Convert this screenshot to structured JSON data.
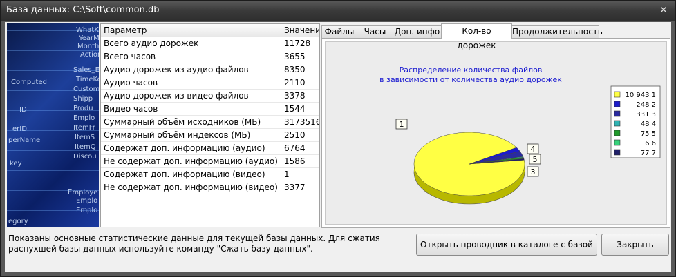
{
  "window": {
    "title": "База данных: C:\\Soft\\common.db",
    "close_glyph": "✕"
  },
  "side_image": {
    "words": [
      "WhatK",
      "YearM",
      "MonthI",
      "Action",
      "Sales_E",
      "TimeKe",
      "Custom",
      "Shipp",
      "Produ",
      "Emplo",
      "ItemFr",
      "ItemS",
      "ItemQ",
      "Discou",
      "Employe",
      "Emplo",
      "Emplo",
      "key",
      "ID",
      "erID",
      "perName",
      "Computed",
      "egory"
    ]
  },
  "grid": {
    "headers": [
      "Параметр",
      "Значение"
    ],
    "rows": [
      [
        "Всего аудио дорожек",
        "11728"
      ],
      [
        "Всего часов",
        "3655"
      ],
      [
        "Аудио дорожек из аудио файлов",
        "8350"
      ],
      [
        "Аудио часов",
        "2110"
      ],
      [
        "Аудио дорожек из видео файлов",
        "3378"
      ],
      [
        "Видео часов",
        "1544"
      ],
      [
        "Суммарный объём исходников (МБ)",
        "3173516"
      ],
      [
        "Суммарный объём индексов  (МБ)",
        "2510"
      ],
      [
        "Содержат доп. информацию (аудио)",
        "6764"
      ],
      [
        "Не содержат доп. информацию (аудио)",
        "1586"
      ],
      [
        "Содержат доп. информацию (видео)",
        "1"
      ],
      [
        "Не содержат доп. информацию (видео)",
        "3377"
      ]
    ]
  },
  "tabs": [
    {
      "label": "Файлы",
      "active": false
    },
    {
      "label": "Часы",
      "active": false
    },
    {
      "label": "Доп. инфо",
      "active": false
    },
    {
      "label": "Кол-во дорожек",
      "active": true
    },
    {
      "label": "Продолжительность",
      "active": false
    }
  ],
  "chart_data": {
    "type": "pie",
    "title": "Распределение количества файлов",
    "subtitle": "в зависимости от количества аудио дорожек",
    "slices": [
      {
        "label": "1",
        "value": 10943,
        "legend": "10 943 1",
        "color": "#ffff44"
      },
      {
        "label": "2",
        "value": 248,
        "legend": "248 2",
        "color": "#1c1ccc"
      },
      {
        "label": "3",
        "value": 331,
        "legend": "331 3",
        "color": "#2a2aa0"
      },
      {
        "label": "4",
        "value": 48,
        "legend": "48 4",
        "color": "#2fb3b3"
      },
      {
        "label": "5",
        "value": 75,
        "legend": "75 5",
        "color": "#1f9a2a"
      },
      {
        "label": "6",
        "value": 6,
        "legend": "6 6",
        "color": "#36d27a"
      },
      {
        "label": "7",
        "value": 77,
        "legend": "77 7",
        "color": "#20206a"
      }
    ],
    "visible_labels": [
      "1",
      "4",
      "5",
      "3"
    ],
    "legend_position": "right"
  },
  "status": {
    "text": "Показаны основные статистические данные для текущей базы данных. Для сжатия распухшей базы данных используйте команду \"Сжать базу данных\"."
  },
  "buttons": {
    "open_explorer": "Открыть проводник в каталоге с базой",
    "close": "Закрыть"
  }
}
